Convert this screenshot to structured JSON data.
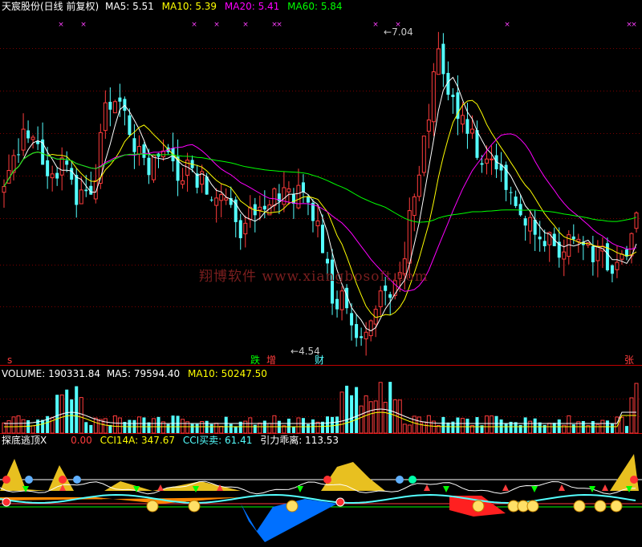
{
  "price_header": {
    "title": "天宸股份(日线 前复权)",
    "ma5": "MA5: 5.51",
    "ma10": "MA10: 5.39",
    "ma20": "MA20: 5.41",
    "ma60": "MA60: 5.84"
  },
  "volume_header": {
    "volume": "VOLUME: 190331.84",
    "ma5": "MA5: 79594.40",
    "ma10": "MA10: 50247.50"
  },
  "indicator_header": {
    "name": "探底逃顶X",
    "value": "0.00",
    "cci14a": "CCI14A: 347.67",
    "cci_trade": "CCI买卖: 61.41",
    "divergence": "引力乖离: 113.53"
  },
  "watermark": "翔博软件 www.xiangbosoft.com",
  "annotations": {
    "high": "7.04",
    "low": "4.54",
    "signal_left": "s",
    "signal_die": "跌",
    "signal_zeng": "增",
    "signal_cai": "财",
    "signal_zhang": "张"
  },
  "colors": {
    "up": "#ff3c3c",
    "down": "#54ffff",
    "ma5": "#ffffff",
    "ma10": "#ffff00",
    "ma20": "#ff00ff",
    "ma60": "#00ff00",
    "axis": "#c00000"
  },
  "chart_data": [
    {
      "type": "candlestick",
      "title": "天宸股份(日线 前复权)",
      "series": [
        {
          "name": "MA5",
          "value": 5.51
        },
        {
          "name": "MA10",
          "value": 5.39
        },
        {
          "name": "MA20",
          "value": 5.41
        },
        {
          "name": "MA60",
          "value": 5.84
        }
      ],
      "close": [
        5.8,
        5.95,
        6.1,
        6.3,
        6.25,
        6.05,
        5.85,
        5.9,
        6.0,
        5.8,
        5.7,
        5.78,
        5.9,
        6.6,
        6.55,
        6.5,
        6.35,
        6.2,
        6.05,
        5.95,
        5.98,
        6.1,
        6.0,
        5.85,
        5.92,
        5.9,
        5.88,
        5.8,
        5.75,
        5.7,
        5.55,
        5.45,
        5.5,
        5.55,
        5.6,
        5.7,
        5.78,
        5.74,
        5.75,
        5.7,
        5.6,
        5.55,
        5.2,
        4.9,
        4.8,
        4.75,
        4.6,
        4.56,
        4.7,
        4.8,
        4.88,
        4.9,
        5.05,
        5.4,
        5.8,
        6.1,
        6.55,
        6.95,
        6.7,
        6.5,
        6.4,
        6.3,
        6.1,
        6.0,
        6.05,
        5.95,
        5.8,
        5.7,
        5.6,
        5.5,
        5.4,
        5.35,
        5.3,
        5.28,
        5.32,
        5.36,
        5.3,
        5.25,
        5.2,
        5.15,
        5.12,
        5.1,
        5.2,
        5.51
      ],
      "high_label": 7.04,
      "low_label": 4.54
    },
    {
      "type": "bar",
      "title": "VOLUME",
      "series": [
        {
          "name": "VOLUME",
          "value": 190331.84
        },
        {
          "name": "MA5",
          "value": 79594.4
        },
        {
          "name": "MA10",
          "value": 50247.5
        }
      ]
    },
    {
      "type": "area",
      "title": "探底逃顶X",
      "series": [
        {
          "name": "探底逃顶X",
          "value": 0.0
        },
        {
          "name": "CCI14A",
          "value": 347.67
        },
        {
          "name": "CCI买卖",
          "value": 61.41
        },
        {
          "name": "引力乖离",
          "value": 113.53
        }
      ]
    }
  ]
}
